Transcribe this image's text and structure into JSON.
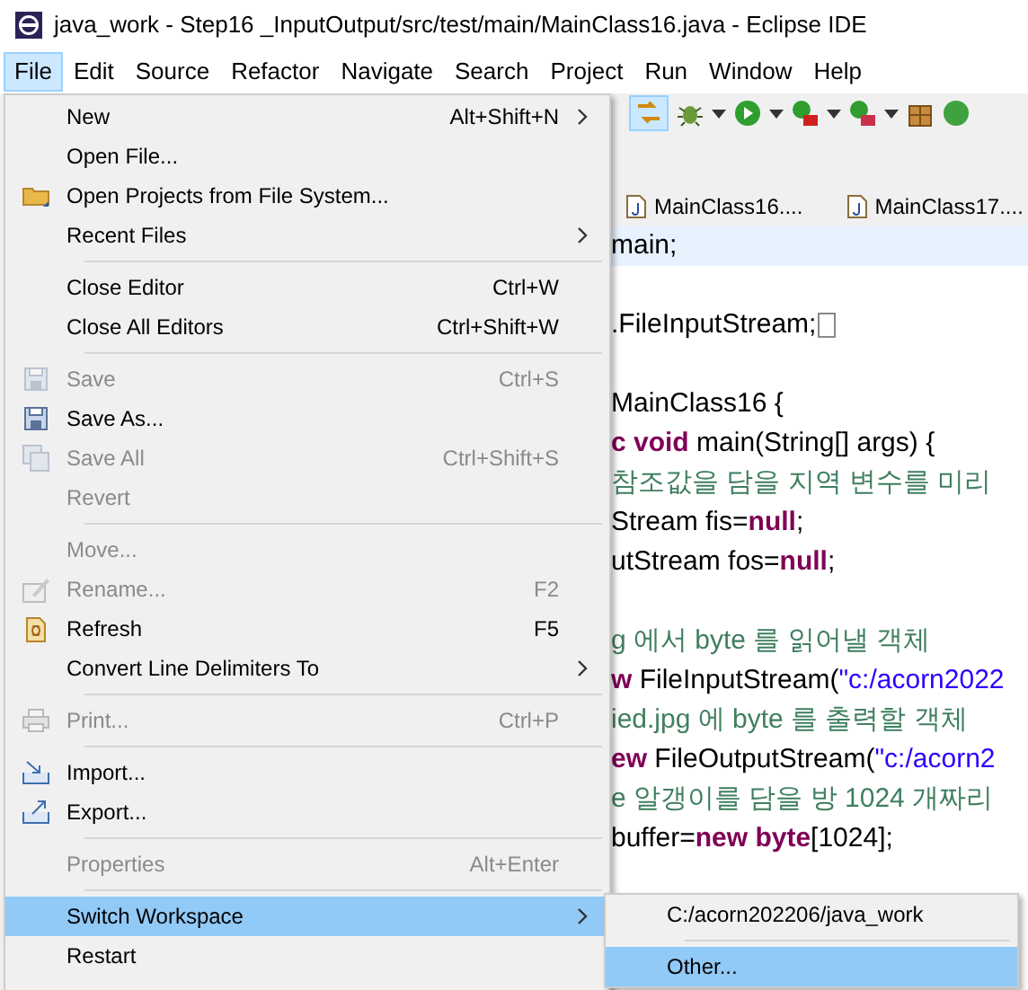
{
  "window": {
    "title": "java_work - Step16 _InputOutput/src/test/main/MainClass16.java - Eclipse IDE"
  },
  "menu_bar": [
    {
      "label": "File",
      "selected": true
    },
    {
      "label": "Edit",
      "selected": false
    },
    {
      "label": "Source",
      "selected": false
    },
    {
      "label": "Refactor",
      "selected": false
    },
    {
      "label": "Navigate",
      "selected": false
    },
    {
      "label": "Search",
      "selected": false
    },
    {
      "label": "Project",
      "selected": false
    },
    {
      "label": "Run",
      "selected": false
    },
    {
      "label": "Window",
      "selected": false
    },
    {
      "label": "Help",
      "selected": false
    }
  ],
  "editor_tabs": [
    {
      "label": "MainClass16...."
    },
    {
      "label": "MainClass17...."
    }
  ],
  "code_lines": [
    {
      "highlighted": true,
      "tokens": [
        {
          "kind": "plain",
          "text": "main;"
        }
      ]
    },
    {
      "highlighted": false
    },
    {
      "highlighted": false,
      "folded": true,
      "tokens": [
        {
          "kind": "plain",
          "text": ".FileInputStream;"
        }
      ]
    },
    {
      "highlighted": false
    },
    {
      "highlighted": false,
      "tokens": [
        {
          "kind": "plain",
          "text": "MainClass16 {"
        }
      ]
    },
    {
      "highlighted": false,
      "tokens": [
        {
          "kind": "keyword",
          "text": "c void"
        },
        {
          "kind": "plain",
          "text": " main(String[] args) {"
        }
      ]
    },
    {
      "highlighted": false,
      "tokens": [
        {
          "kind": "comment",
          "text": "참조값을 담을 지역 변수를 미리"
        }
      ]
    },
    {
      "highlighted": false,
      "tokens": [
        {
          "kind": "plain",
          "text": "Stream fis="
        },
        {
          "kind": "keyword",
          "text": "null"
        },
        {
          "kind": "plain",
          "text": ";"
        }
      ]
    },
    {
      "highlighted": false,
      "tokens": [
        {
          "kind": "plain",
          "text": "utStream fos="
        },
        {
          "kind": "keyword",
          "text": "null"
        },
        {
          "kind": "plain",
          "text": ";"
        }
      ]
    },
    {
      "highlighted": false
    },
    {
      "highlighted": false,
      "tokens": [
        {
          "kind": "comment",
          "text": "g 에서 byte 를 읽어낼 객체"
        }
      ]
    },
    {
      "highlighted": false,
      "tokens": [
        {
          "kind": "keyword",
          "text": "w"
        },
        {
          "kind": "plain",
          "text": " FileInputStream("
        },
        {
          "kind": "string",
          "text": "\"c:/acorn2022"
        }
      ]
    },
    {
      "highlighted": false,
      "tokens": [
        {
          "kind": "comment",
          "text": "ied.jpg 에 byte 를 출력할 객체"
        }
      ]
    },
    {
      "highlighted": false,
      "tokens": [
        {
          "kind": "keyword",
          "text": "ew"
        },
        {
          "kind": "plain",
          "text": " FileOutputStream("
        },
        {
          "kind": "string",
          "text": "\"c:/acorn2"
        }
      ]
    },
    {
      "highlighted": false,
      "tokens": [
        {
          "kind": "comment",
          "text": "e 알갱이를 담을 방 1024 개짜리"
        }
      ]
    },
    {
      "highlighted": false,
      "tokens": [
        {
          "kind": "plain",
          "text": "buffer="
        },
        {
          "kind": "keyword",
          "text": "new byte"
        },
        {
          "kind": "plain",
          "text": "[1024];"
        }
      ]
    }
  ],
  "file_menu": [
    {
      "kind": "item",
      "label": "New",
      "shortcut": "Alt+Shift+N",
      "submenu": true,
      "disabled": false,
      "selected": false
    },
    {
      "kind": "item",
      "label": "Open File...",
      "disabled": false,
      "selected": false
    },
    {
      "kind": "item",
      "label": "Open Projects from File System...",
      "disabled": false,
      "selected": false
    },
    {
      "kind": "item",
      "label": "Recent Files",
      "submenu": true,
      "disabled": false,
      "selected": false
    },
    {
      "kind": "separator"
    },
    {
      "kind": "item",
      "label": "Close Editor",
      "shortcut": "Ctrl+W",
      "disabled": false,
      "selected": false
    },
    {
      "kind": "item",
      "label": "Close All Editors",
      "shortcut": "Ctrl+Shift+W",
      "disabled": false,
      "selected": false
    },
    {
      "kind": "separator"
    },
    {
      "kind": "item",
      "label": "Save",
      "shortcut": "Ctrl+S",
      "disabled": true,
      "selected": false
    },
    {
      "kind": "item",
      "label": "Save As...",
      "disabled": false,
      "selected": false
    },
    {
      "kind": "item",
      "label": "Save All",
      "shortcut": "Ctrl+Shift+S",
      "disabled": true,
      "selected": false
    },
    {
      "kind": "item",
      "label": "Revert",
      "disabled": true,
      "selected": false
    },
    {
      "kind": "separator"
    },
    {
      "kind": "item",
      "label": "Move...",
      "disabled": true,
      "selected": false
    },
    {
      "kind": "item",
      "label": "Rename...",
      "shortcut": "F2",
      "disabled": true,
      "selected": false
    },
    {
      "kind": "item",
      "label": "Refresh",
      "shortcut": "F5",
      "disabled": false,
      "selected": false
    },
    {
      "kind": "item",
      "label": "Convert Line Delimiters To",
      "submenu": true,
      "disabled": false,
      "selected": false
    },
    {
      "kind": "separator"
    },
    {
      "kind": "item",
      "label": "Print...",
      "shortcut": "Ctrl+P",
      "disabled": true,
      "selected": false
    },
    {
      "kind": "separator"
    },
    {
      "kind": "item",
      "label": "Import...",
      "disabled": false,
      "selected": false
    },
    {
      "kind": "item",
      "label": "Export...",
      "disabled": false,
      "selected": false
    },
    {
      "kind": "separator"
    },
    {
      "kind": "item",
      "label": "Properties",
      "shortcut": "Alt+Enter",
      "disabled": true,
      "selected": false
    },
    {
      "kind": "separator"
    },
    {
      "kind": "item",
      "label": "Switch Workspace",
      "submenu": true,
      "disabled": false,
      "selected": true
    },
    {
      "kind": "item",
      "label": "Restart",
      "disabled": false,
      "selected": false
    }
  ],
  "workspace_submenu": [
    {
      "kind": "item",
      "label": "C:/acorn202206/java_work",
      "selected": false
    },
    {
      "kind": "separator"
    },
    {
      "kind": "item",
      "label": "Other...",
      "selected": true
    }
  ]
}
